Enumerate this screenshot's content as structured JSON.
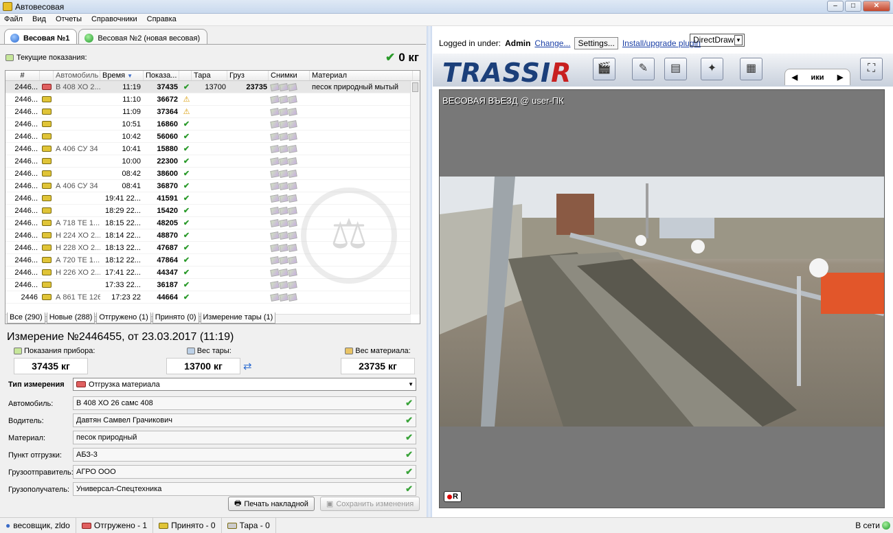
{
  "window": {
    "title": "Автовесовая"
  },
  "menu": [
    "Файл",
    "Вид",
    "Отчеты",
    "Справочники",
    "Справка"
  ],
  "tabs": [
    {
      "label": "Весовая №1"
    },
    {
      "label": "Весовая №2 (новая весовая)"
    }
  ],
  "current": {
    "label": "Текущие показания:",
    "value": "0 кг"
  },
  "table": {
    "headers": [
      "#",
      "Автомобиль",
      "Время",
      "Показа...",
      "Тара",
      "Груз",
      "Снимки",
      "Материал"
    ],
    "rows": [
      {
        "id": "2446...",
        "car": "В 408 ХО 2...",
        "time": "11:19",
        "read": "37435",
        "status": "ok",
        "tare": "13700",
        "load": "23735",
        "material": "песок природный мытый"
      },
      {
        "id": "2446...",
        "car": "",
        "time": "11:10",
        "read": "36672",
        "status": "warn",
        "tare": "",
        "load": "",
        "material": ""
      },
      {
        "id": "2446...",
        "car": "",
        "time": "11:09",
        "read": "37364",
        "status": "warn",
        "tare": "",
        "load": "",
        "material": ""
      },
      {
        "id": "2446...",
        "car": "",
        "time": "10:51",
        "read": "16860",
        "status": "ok",
        "tare": "",
        "load": "",
        "material": ""
      },
      {
        "id": "2446...",
        "car": "",
        "time": "10:42",
        "read": "56060",
        "status": "ok",
        "tare": "",
        "load": "",
        "material": ""
      },
      {
        "id": "2446...",
        "car": "А 406 СУ 34",
        "time": "10:41",
        "read": "15880",
        "status": "ok",
        "tare": "",
        "load": "",
        "material": ""
      },
      {
        "id": "2446...",
        "car": "",
        "time": "10:00",
        "read": "22300",
        "status": "ok",
        "tare": "",
        "load": "",
        "material": ""
      },
      {
        "id": "2446...",
        "car": "",
        "time": "08:42",
        "read": "38600",
        "status": "ok",
        "tare": "",
        "load": "",
        "material": ""
      },
      {
        "id": "2446...",
        "car": "А 406 СУ 34",
        "time": "08:41",
        "read": "36870",
        "status": "ok",
        "tare": "",
        "load": "",
        "material": ""
      },
      {
        "id": "2446...",
        "car": "",
        "time": "19:41 22...",
        "read": "41591",
        "status": "ok",
        "tare": "",
        "load": "",
        "material": ""
      },
      {
        "id": "2446...",
        "car": "",
        "time": "18:29 22...",
        "read": "15420",
        "status": "ok",
        "tare": "",
        "load": "",
        "material": ""
      },
      {
        "id": "2446...",
        "car": "А 718 ТЕ 1...",
        "time": "18:15 22...",
        "read": "48205",
        "status": "ok",
        "tare": "",
        "load": "",
        "material": ""
      },
      {
        "id": "2446...",
        "car": "Н 224 ХО 2...",
        "time": "18:14 22...",
        "read": "48870",
        "status": "ok",
        "tare": "",
        "load": "",
        "material": ""
      },
      {
        "id": "2446...",
        "car": "Н 228 ХО 2...",
        "time": "18:13 22...",
        "read": "47687",
        "status": "ok",
        "tare": "",
        "load": "",
        "material": ""
      },
      {
        "id": "2446...",
        "car": "А 720 ТЕ 1...",
        "time": "18:12 22...",
        "read": "47864",
        "status": "ok",
        "tare": "",
        "load": "",
        "material": ""
      },
      {
        "id": "2446...",
        "car": "Н 226 ХО 2...",
        "time": "17:41 22...",
        "read": "44347",
        "status": "ok",
        "tare": "",
        "load": "",
        "material": ""
      },
      {
        "id": "2446...",
        "car": "",
        "time": "17:33 22...",
        "read": "36187",
        "status": "ok",
        "tare": "",
        "load": "",
        "material": ""
      },
      {
        "id": "2446",
        "car": "А 861 ТЕ 126",
        "time": "17:23 22",
        "read": "44664",
        "status": "ok",
        "tare": "",
        "load": "",
        "material": ""
      }
    ]
  },
  "filters": [
    "Все (290)",
    "Новые (288)",
    "Отгружено (1)",
    "Принято (0)",
    "Измерение тары (1)"
  ],
  "measurement": {
    "title": "Измерение №2446455, от 23.03.2017 (11:19)",
    "device_label": "Показания прибора:",
    "device_value": "37435 кг",
    "tare_label": "Вес тары:",
    "tare_value": "13700 кг",
    "material_label": "Вес материала:",
    "material_value": "23735 кг"
  },
  "form": {
    "type_label": "Тип измерения",
    "type_value": "Отгрузка материала",
    "fields": [
      {
        "label": "Автомобиль:",
        "value": "В 408 ХО 26 самс 408"
      },
      {
        "label": "Водитель:",
        "value": "Давтян Самвел Грачикович"
      },
      {
        "label": "Материал:",
        "value": "песок природный"
      },
      {
        "label": "Пункт отгрузки:",
        "value": "АБЗ-3"
      },
      {
        "label": "Грузоотправитель:",
        "value": "АГРО ООО"
      },
      {
        "label": "Грузополучатель:",
        "value": "Универсал-Спецтехника"
      }
    ],
    "print_label": "Печать накладной",
    "save_label": "Сохранить изменения"
  },
  "trassir": {
    "logged_in": "Logged in under:",
    "user": "Admin",
    "change": "Change...",
    "settings": "Settings...",
    "install": "Install/upgrade plugin",
    "render": "DirectDraw",
    "logo_main": "TRASSI",
    "logo_r": "R",
    "tab_label": "ики",
    "camera_label": "ВЕСОВАЯ ВЪЕЗД @ user-ПК",
    "rec_label": "R"
  },
  "status": {
    "user": "весовщик, zldo",
    "shipped": "Отгружено - 1",
    "accepted": "Принято - 0",
    "tare": "Тара - 0",
    "online": "В сети"
  }
}
